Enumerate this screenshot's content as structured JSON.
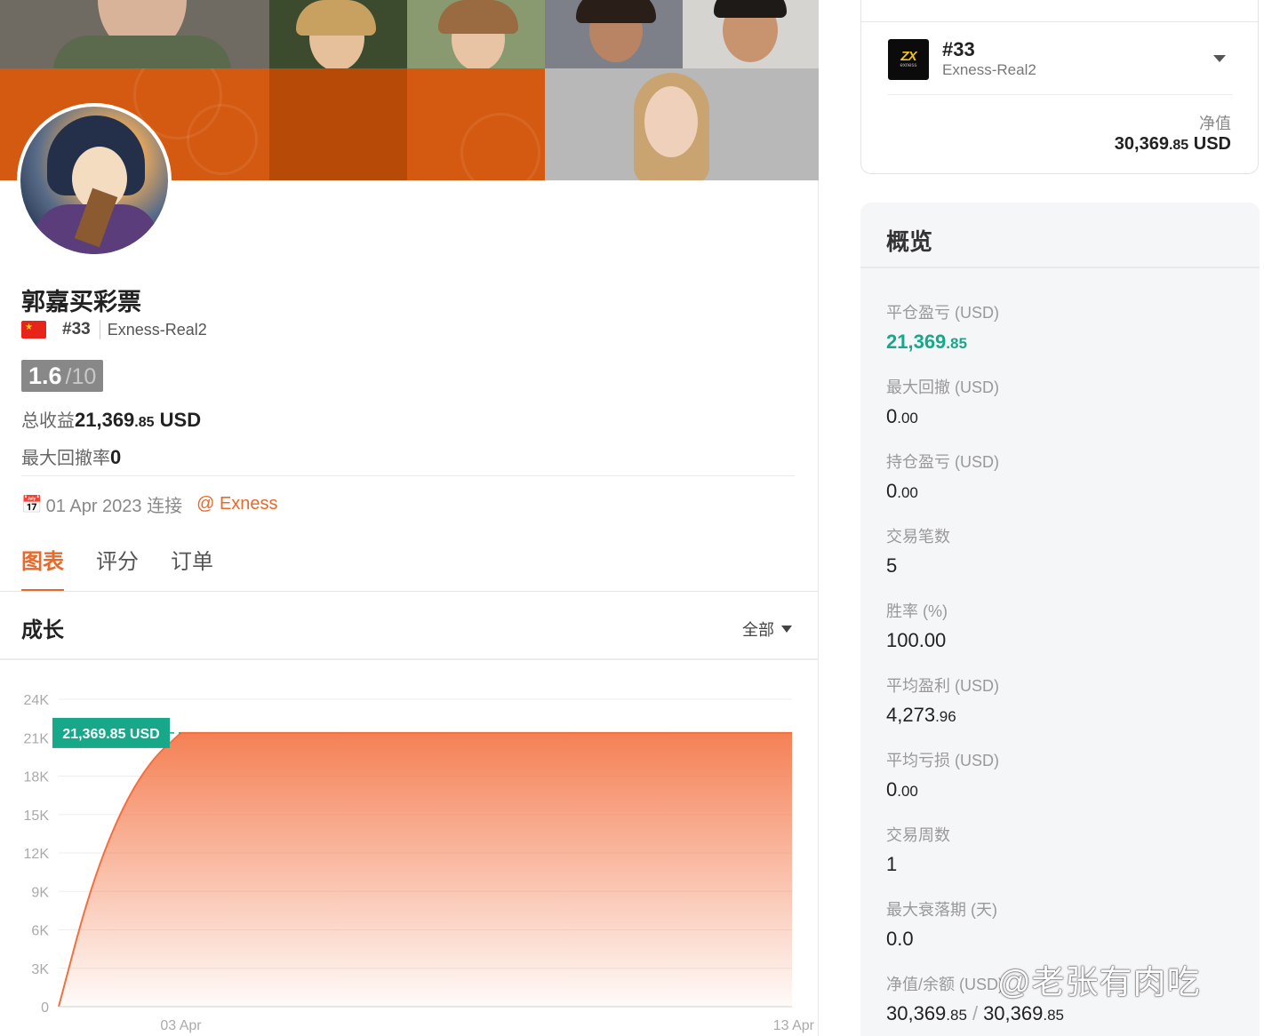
{
  "profile": {
    "name": "郭嘉买彩票",
    "account_number": "#33",
    "server": "Exness-Real2",
    "score": "1.6",
    "score_max": "/10",
    "total_profit_label": "总收益",
    "total_profit_int": "21,369",
    "total_profit_dec": ".85",
    "total_profit_unit": " USD",
    "max_drawdown_label": "最大回撤率",
    "max_drawdown_value": "0",
    "connect_date": "01 Apr 2023 连接",
    "broker_link": "@ Exness"
  },
  "tabs": [
    {
      "label": "图表",
      "active": true
    },
    {
      "label": "评分",
      "active": false
    },
    {
      "label": "订单",
      "active": false
    }
  ],
  "growth": {
    "title": "成长",
    "filter_label": "全部"
  },
  "chart_data": {
    "type": "area",
    "title": "",
    "y_ticks": [
      "24K",
      "21K",
      "18K",
      "15K",
      "12K",
      "9K",
      "6K",
      "3K",
      "0"
    ],
    "ylim": [
      0,
      24000
    ],
    "x_ticks": [
      {
        "label": "03 Apr",
        "day": 3
      },
      {
        "label": "13 Apr",
        "day": 13
      }
    ],
    "xlim_days": [
      1,
      13
    ],
    "series": [
      {
        "x_days": [
          1,
          1.5,
          2,
          2.5,
          3,
          13
        ],
        "y": [
          0,
          9000,
          15200,
          19200,
          21369.85,
          21369.85
        ]
      }
    ],
    "current_value_label": "21,369.85 USD",
    "current_value": 21369.85,
    "colors": {
      "line": "#f07040",
      "fill_top": "#f47a4c",
      "marker": "#17a88a"
    }
  },
  "account_card": {
    "number": "#33",
    "server": "Exness-Real2",
    "logo_text_main": "ZX",
    "logo_text_sub": "exness",
    "equity_label": "净值",
    "equity_int": "30,369",
    "equity_dec": ".85",
    "equity_unit": " USD"
  },
  "overview": {
    "title": "概览",
    "metrics": [
      {
        "label": "平仓盈亏 (USD)",
        "int": "21,369",
        "dec": ".85",
        "green": true
      },
      {
        "label": "最大回撤 (USD)",
        "int": "0",
        "dec": ".00"
      },
      {
        "label": "持仓盈亏 (USD)",
        "int": "0",
        "dec": ".00"
      },
      {
        "label": "交易笔数",
        "int": "5",
        "dec": ""
      },
      {
        "label": "胜率 (%)",
        "int": "100.00",
        "dec": ""
      },
      {
        "label": "平均盈利 (USD)",
        "int": "4,273",
        "dec": ".96"
      },
      {
        "label": "平均亏损 (USD)",
        "int": "0",
        "dec": ".00"
      },
      {
        "label": "交易周数",
        "int": "1",
        "dec": ""
      },
      {
        "label": "最大衰落期 (天)",
        "int": "0.0",
        "dec": ""
      }
    ],
    "equity_balance_label": "净值/余额 (USD)",
    "equity_int": "30,369",
    "equity_dec": ".85",
    "balance_int": "30,369",
    "balance_dec": ".85"
  },
  "watermark": "@老张有肉吃",
  "colors": {
    "accent": "#e8692a",
    "green": "#17a88a",
    "banner_orange": "#d45a11"
  }
}
